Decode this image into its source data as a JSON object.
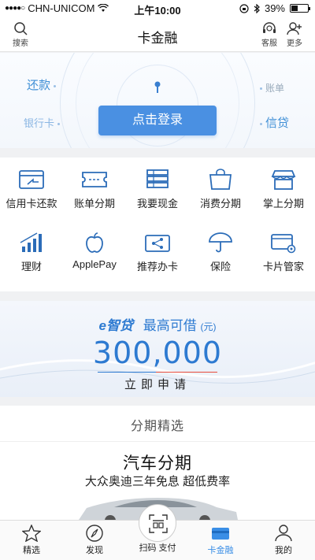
{
  "status_bar": {
    "signal": "●●●●○",
    "carrier": "CHN-UNICOM",
    "time": "上午10:00",
    "battery_text": "39%",
    "battery_level": 0.39
  },
  "nav": {
    "title": "卡金融",
    "search_label": "搜索",
    "service_label": "客服",
    "more_label": "更多"
  },
  "hero": {
    "repay_label": "还款",
    "bankcard_label": "银行卡",
    "bill_label": "账单",
    "credit_label": "信贷",
    "login_button": "点击登录"
  },
  "grid": {
    "items": [
      {
        "label": "信用卡还款",
        "icon": "card-repay-icon"
      },
      {
        "label": "账单分期",
        "icon": "ticket-icon"
      },
      {
        "label": "我要现金",
        "icon": "cash-stack-icon"
      },
      {
        "label": "消费分期",
        "icon": "shopping-bag-icon"
      },
      {
        "label": "掌上分期",
        "icon": "storefront-icon"
      },
      {
        "label": "理财",
        "icon": "bar-growth-icon"
      },
      {
        "label": "ApplePay",
        "icon": "apple-icon"
      },
      {
        "label": "推荐办卡",
        "icon": "share-card-icon"
      },
      {
        "label": "保险",
        "icon": "umbrella-icon"
      },
      {
        "label": "卡片管家",
        "icon": "card-settings-icon"
      }
    ]
  },
  "loan": {
    "brand": "e智贷",
    "headline": "最高可借",
    "unit": "(元)",
    "amount": "300,000",
    "cta": "立即申请"
  },
  "featured": {
    "section_title": "分期精选",
    "promo_title": "汽车分期",
    "promo_subtitle": "大众奥迪三年免息 超低费率"
  },
  "tabs": [
    {
      "label": "精选",
      "icon": "star-icon"
    },
    {
      "label": "发现",
      "icon": "compass-icon"
    },
    {
      "label": "扫码 支付",
      "icon": "scan-pay-icon"
    },
    {
      "label": "卡金融",
      "icon": "card-icon"
    },
    {
      "label": "我的",
      "icon": "person-icon"
    }
  ],
  "colors": {
    "accent": "#4a90e2",
    "active_tab": "#3a8ee6",
    "loan_blue": "#2d7ad1"
  }
}
